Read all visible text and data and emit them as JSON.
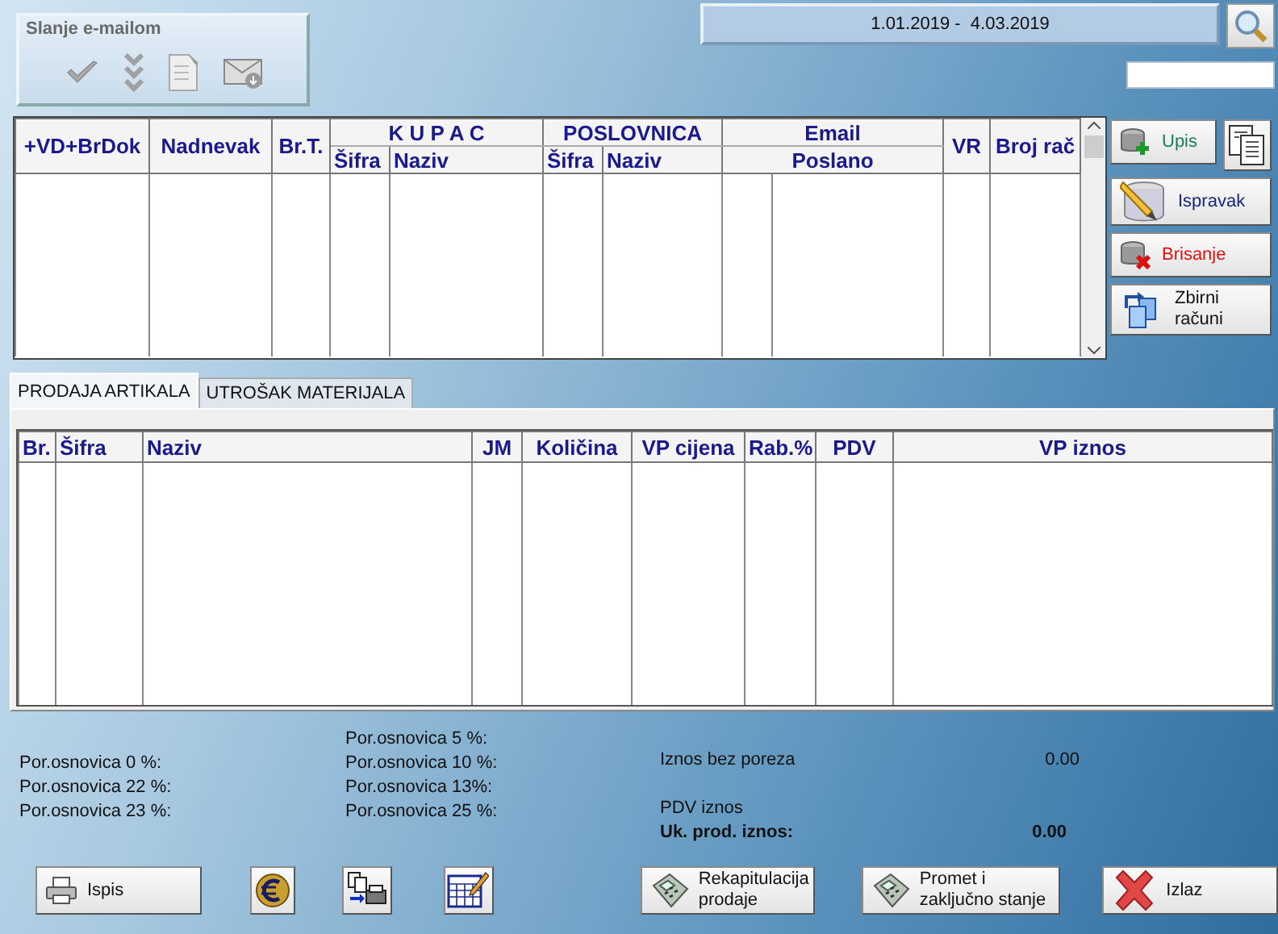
{
  "email_panel": {
    "title": "Slanje e-mailom",
    "actions": [
      {
        "kind": "check",
        "disabled": true
      },
      {
        "kind": "double-check",
        "disabled": true
      },
      {
        "kind": "document",
        "disabled": true
      },
      {
        "kind": "envelope",
        "disabled": true
      }
    ]
  },
  "date_range": "1.01.2019 -  4.03.2019",
  "documents_table": {
    "columns": [
      {
        "label": "+VD+BrDok"
      },
      {
        "label": "Nadnevak"
      },
      {
        "label": "Br.T."
      },
      {
        "label": "K U P A C",
        "children": [
          {
            "label": "Šifra"
          },
          {
            "label": "Naziv"
          }
        ]
      },
      {
        "label": "POSLOVNICA",
        "children": [
          {
            "label": "Šifra"
          },
          {
            "label": "Naziv"
          }
        ]
      },
      {
        "label": "Email",
        "children": [
          {
            "label": "Poslano"
          }
        ]
      },
      {
        "label": "VR"
      },
      {
        "label": "Broj rač"
      }
    ]
  },
  "side_buttons": [
    {
      "kind": "add",
      "label": "Upis"
    },
    {
      "kind": "copy"
    },
    {
      "kind": "edit",
      "label": "Ispravak"
    },
    {
      "kind": "delete",
      "label": "Brisanje"
    },
    {
      "kind": "merge",
      "label": "Zbirni računi"
    }
  ],
  "tabs": [
    {
      "label": "PRODAJA ARTIKALA",
      "selected": true
    },
    {
      "label": "UTROŠAK MATERIJALA",
      "selected": false
    }
  ],
  "items_table": {
    "columns": [
      "Br.",
      "Šifra",
      "Naziv",
      "JM",
      "Količina",
      "VP cijena",
      "Rab.%",
      "PDV",
      "VP iznos"
    ]
  },
  "tax_bases": {
    "column_1": [
      "Por.osnovica 0 %:",
      "Por.osnovica 22 %:",
      "Por.osnovica 23 %:"
    ],
    "column_2": [
      "Por.osnovica 5 %:",
      "Por.osnovica 10 %:",
      "Por.osnovica 13%:",
      "Por.osnovica 25 %:"
    ]
  },
  "totals": [
    {
      "label": "Iznos bez poreza",
      "value": "0.00",
      "bold": false
    },
    {
      "label": "PDV iznos",
      "bold": false
    },
    {
      "label": "Uk. prod. iznos:",
      "value": "0.00",
      "bold": true
    }
  ],
  "bottom_buttons": [
    {
      "kind": "print",
      "label": "Ispis"
    },
    {
      "kind": "euro"
    },
    {
      "kind": "print-transfer"
    },
    {
      "kind": "table-edit"
    },
    {
      "kind": "calculator",
      "label": "Rekapitulacija prodaje"
    },
    {
      "kind": "calculator",
      "label": "Promet i zaključno stanje"
    },
    {
      "kind": "exit",
      "label": "Izlaz"
    }
  ]
}
